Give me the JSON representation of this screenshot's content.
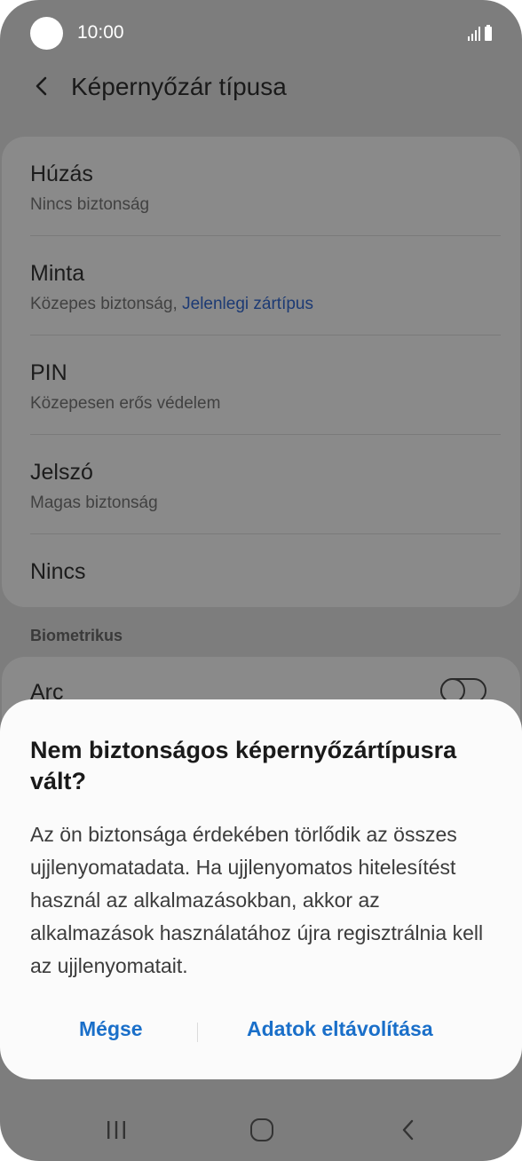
{
  "status_bar": {
    "time": "10:00"
  },
  "header": {
    "title": "Képernyőzár típusa"
  },
  "lock_options": [
    {
      "title": "Húzás",
      "subtitle": "Nincs biztonság",
      "subtitle_highlight": ""
    },
    {
      "title": "Minta",
      "subtitle": "Közepes biztonság, ",
      "subtitle_highlight": "Jelenlegi zártípus"
    },
    {
      "title": "PIN",
      "subtitle": "Közepesen erős védelem",
      "subtitle_highlight": ""
    },
    {
      "title": "Jelszó",
      "subtitle": "Magas biztonság",
      "subtitle_highlight": ""
    },
    {
      "title": "Nincs",
      "subtitle": "",
      "subtitle_highlight": ""
    }
  ],
  "biometrics": {
    "section_label": "Biometrikus",
    "face": {
      "label": "Arc",
      "enabled": false
    }
  },
  "dialog": {
    "title": "Nem biztonságos képernyőzártípusra vált?",
    "body": "Az ön biztonsága érdekében törlődik az összes ujjlenyomatadata. Ha ujjlenyomatos hitelesítést használ az alkalmazásokban, akkor az alkalmazások használatához újra regisztrálnia kell az ujjlenyomatait.",
    "cancel_label": "Mégse",
    "confirm_label": "Adatok eltávolítása"
  },
  "colors": {
    "accent": "#1a6fc9",
    "highlight": "#1c3a74"
  },
  "icons": {
    "back": "chevron-left-icon",
    "recent": "recent-apps-icon",
    "home": "home-icon",
    "nav_back": "nav-back-icon"
  }
}
